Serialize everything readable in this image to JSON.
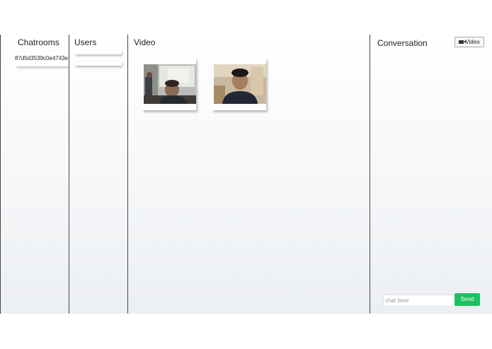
{
  "chatrooms": {
    "heading": "Chatrooms",
    "items": [
      {
        "label": "87d5d3539c0e4743e"
      }
    ]
  },
  "users": {
    "heading": "Users",
    "items": [
      {
        "label": ""
      },
      {
        "label": ""
      }
    ]
  },
  "video": {
    "heading": "Video",
    "tiles": [
      {
        "icon": "webcam-feed-participant-1"
      },
      {
        "icon": "webcam-feed-participant-2"
      }
    ]
  },
  "conversation": {
    "heading": "Conversation",
    "video_button_label": "Video",
    "video_button_icon": "video-camera-icon",
    "input_placeholder": "chat here",
    "input_value": "",
    "send_label": "Send"
  },
  "colors": {
    "send_button": "#1ec15f",
    "divider": "#444444",
    "background_gradient_end": "#eceff2"
  }
}
